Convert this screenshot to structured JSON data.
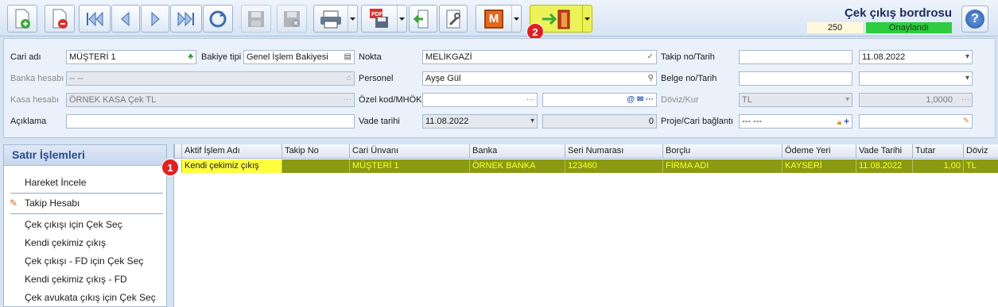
{
  "window": {
    "title": "Çek çıkış bordrosu",
    "doc_number": "250",
    "status": "Onaylandı"
  },
  "toolbar": {
    "icons": [
      "new-doc-icon",
      "delete-doc-icon",
      "first-record-icon",
      "previous-record-icon",
      "next-record-icon",
      "last-record-icon",
      "refresh-icon",
      "save-icon",
      "cancel-save-icon",
      "print-icon",
      "pdf-export-icon",
      "import-icon",
      "settings-icon",
      "m-icon",
      "exit-door-icon",
      "help-icon"
    ],
    "m_label": "M",
    "pdf_label": "PDF",
    "help_label": "?"
  },
  "markers": {
    "one": "1",
    "two": "2"
  },
  "form": {
    "cari_adi": {
      "label": "Cari adı",
      "value": "MÜŞTERİ 1"
    },
    "bakiye_tipi": {
      "label": "Bakiye tipi",
      "value": "Genel İşlem Bakiyesi"
    },
    "banka_hesabi": {
      "label": "Banka hesabı",
      "value": "-- --"
    },
    "kasa_hesabi": {
      "label": "Kasa hesabı",
      "value": "ÖRNEK KASA Çek TL"
    },
    "aciklama": {
      "label": "Açıklama",
      "value": ""
    },
    "nokta": {
      "label": "Nokta",
      "value": "MELİKGAZİ"
    },
    "personel": {
      "label": "Personel",
      "value": "Ayşe Gül"
    },
    "ozel_kod": {
      "label": "Özel kod/MHÖK",
      "value": "",
      "value2": ""
    },
    "vade_tarihi": {
      "label": "Vade tarihi",
      "value": "11.08.2022",
      "value2": "0"
    },
    "takip_no": {
      "label": "Takip no/Tarih",
      "value": "",
      "date": "11.08.2022"
    },
    "belge_no": {
      "label": "Belge no/Tarih",
      "value": "",
      "date": " .  .      :  :"
    },
    "doviz_kur": {
      "label": "Döviz/Kur",
      "currency": "TL",
      "rate": "1,0000"
    },
    "proje": {
      "label": "Proje/Cari bağlantı",
      "value": "--- ---",
      "value2": ""
    }
  },
  "left_panel": {
    "title": "Satır İşlemleri",
    "items": [
      "Hareket İncele",
      "Takip Hesabı",
      "Çek çıkışı için Çek Seç",
      "Kendi çekimiz çıkış",
      "Çek çıkışı - FD için Çek Seç",
      "Kendi çekimiz çıkış - FD",
      "Çek avukata çıkış için Çek Seç"
    ]
  },
  "grid": {
    "columns": [
      "Aktif İşlem Adı",
      "Takip No",
      "Cari Ünvanı",
      "Banka",
      "Seri Numarası",
      "Borçlu",
      "Ödeme Yeri",
      "Vade Tarihi",
      "Tutar",
      "Döviz"
    ],
    "rows": [
      [
        "Kendi çekimiz çıkış",
        "",
        "MÜŞTERİ 1",
        "ÖRNEK BANKA",
        "123460",
        "FİRMA ADI",
        "KAYSERİ",
        "11.08.2022",
        "1,00",
        "TL"
      ]
    ]
  }
}
